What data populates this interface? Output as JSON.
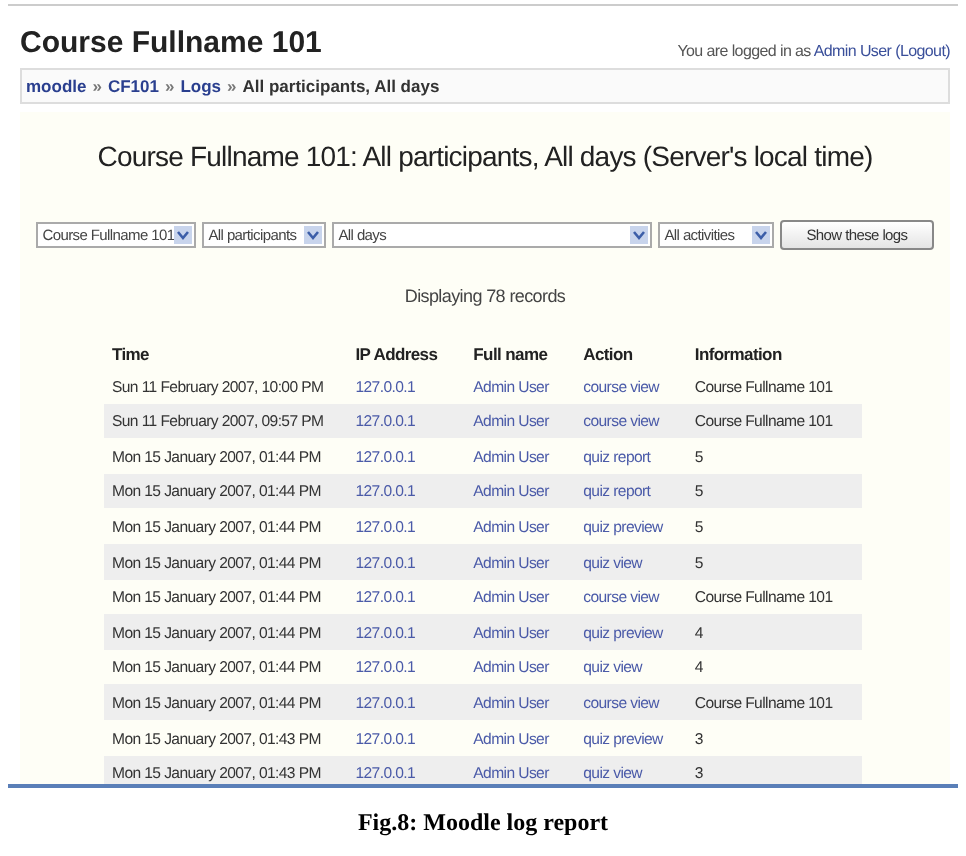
{
  "header": {
    "title": "Course Fullname 101",
    "login_text": "You are logged in as",
    "user_link": "Admin User",
    "logout_link": "(Logout)"
  },
  "breadcrumb": [
    {
      "label": "moodle",
      "current": false
    },
    {
      "label": "CF101",
      "current": false
    },
    {
      "label": "Logs",
      "current": false
    },
    {
      "label": "All participants, All days",
      "current": true
    }
  ],
  "breadcrumb_separator": "»",
  "heading": "Course Fullname 101: All participants, All days (Server's local time)",
  "filters": [
    {
      "value": "Course Fullname 101"
    },
    {
      "value": "All participants"
    },
    {
      "value": "All days"
    },
    {
      "value": "All activities"
    }
  ],
  "show_button": "Show these logs",
  "record_count": "Displaying 78 records",
  "table": {
    "columns": [
      "Time",
      "IP Address",
      "Full name",
      "Action",
      "Information"
    ],
    "rows": [
      [
        "Sun 11 February 2007, 10:00 PM",
        "127.0.0.1",
        "Admin User",
        "course view",
        "Course Fullname 101"
      ],
      [
        "Sun 11 February 2007, 09:57 PM",
        "127.0.0.1",
        "Admin User",
        "course view",
        "Course Fullname 101"
      ],
      [
        "Mon 15 January 2007, 01:44 PM",
        "127.0.0.1",
        "Admin User",
        "quiz report",
        "5"
      ],
      [
        "Mon 15 January 2007, 01:44 PM",
        "127.0.0.1",
        "Admin User",
        "quiz report",
        "5"
      ],
      [
        "Mon 15 January 2007, 01:44 PM",
        "127.0.0.1",
        "Admin User",
        "quiz preview",
        "5"
      ],
      [
        "Mon 15 January 2007, 01:44 PM",
        "127.0.0.1",
        "Admin User",
        "quiz view",
        "5"
      ],
      [
        "Mon 15 January 2007, 01:44 PM",
        "127.0.0.1",
        "Admin User",
        "course view",
        "Course Fullname 101"
      ],
      [
        "Mon 15 January 2007, 01:44 PM",
        "127.0.0.1",
        "Admin User",
        "quiz preview",
        "4"
      ],
      [
        "Mon 15 January 2007, 01:44 PM",
        "127.0.0.1",
        "Admin User",
        "quiz view",
        "4"
      ],
      [
        "Mon 15 January 2007, 01:44 PM",
        "127.0.0.1",
        "Admin User",
        "course view",
        "Course Fullname 101"
      ],
      [
        "Mon 15 January 2007, 01:43 PM",
        "127.0.0.1",
        "Admin User",
        "quiz preview",
        "3"
      ],
      [
        "Mon 15 January 2007, 01:43 PM",
        "127.0.0.1",
        "Admin User",
        "quiz view",
        "3"
      ]
    ]
  },
  "caption": "Fig.8: Moodle log report"
}
